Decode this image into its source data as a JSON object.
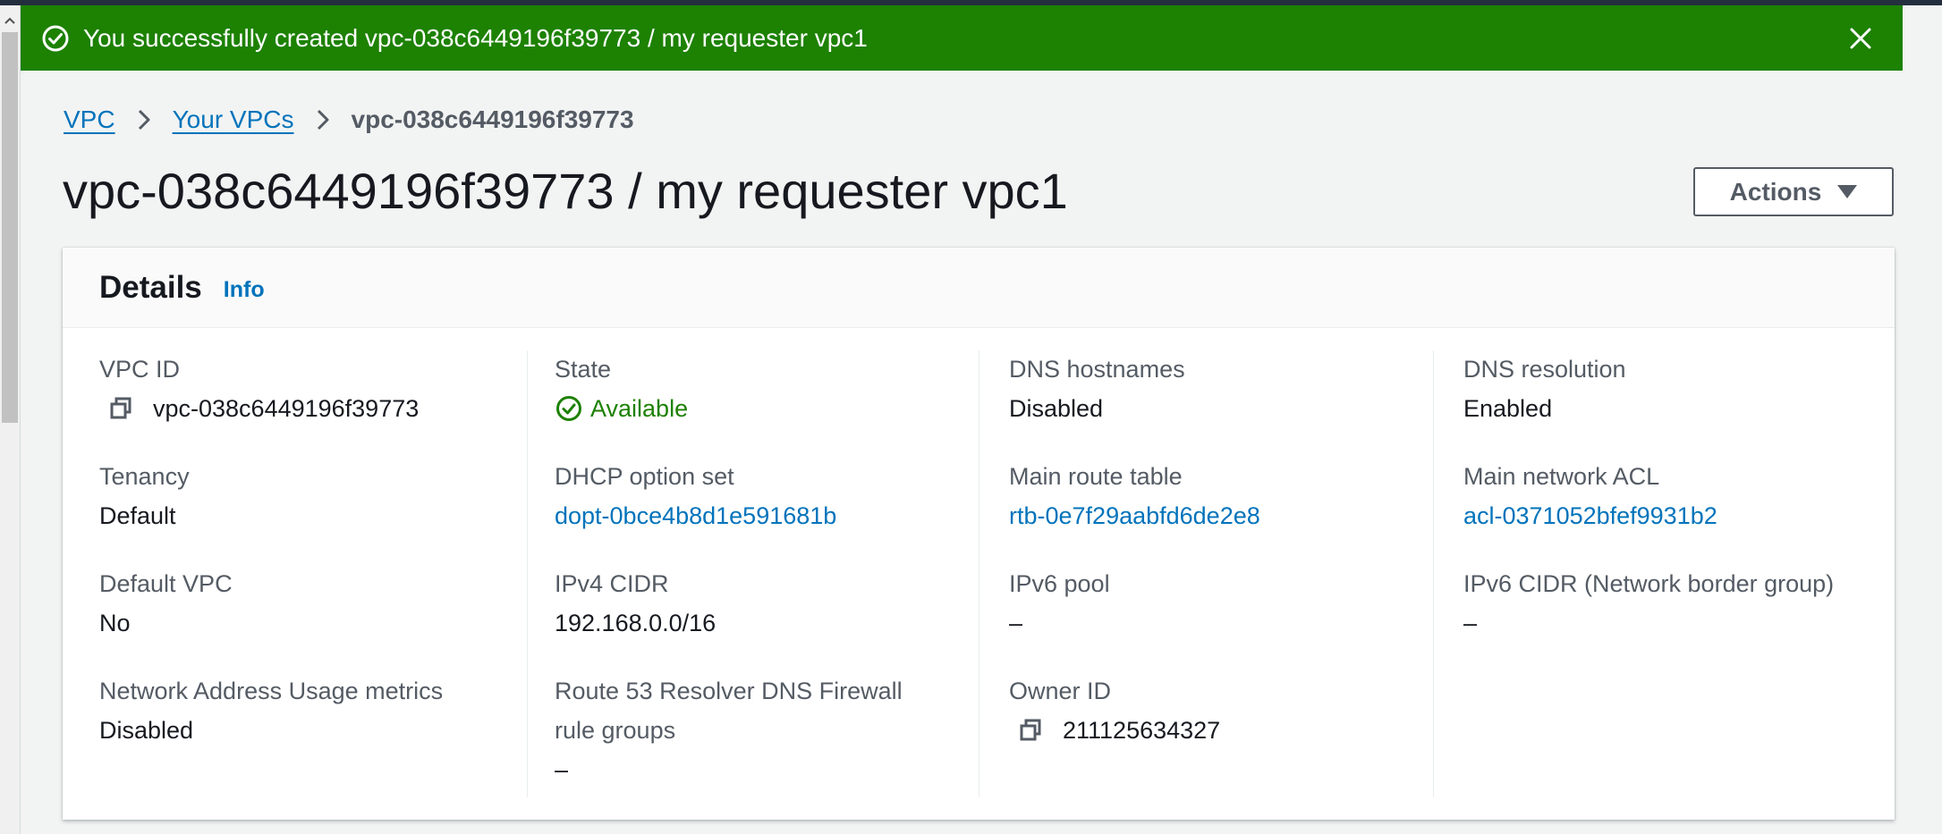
{
  "flash": {
    "message": "You successfully created vpc-038c6449196f39773 / my requester vpc1",
    "type": "success",
    "color": "#1d8102"
  },
  "breadcrumb": {
    "items": [
      "VPC",
      "Your VPCs"
    ],
    "current": "vpc-038c6449196f39773"
  },
  "page": {
    "title": "vpc-038c6449196f39773 / my requester vpc1",
    "actions_label": "Actions"
  },
  "details": {
    "title": "Details",
    "info_label": "Info",
    "columns": [
      [
        {
          "label": "VPC ID",
          "value": "vpc-038c6449196f39773"
        },
        {
          "label": "Tenancy",
          "value": "Default"
        },
        {
          "label": "Default VPC",
          "value": "No"
        },
        {
          "label": "Network Address Usage metrics",
          "value": "Disabled"
        }
      ],
      [
        {
          "label": "State",
          "value": "Available"
        },
        {
          "label": "DHCP option set",
          "value": "dopt-0bce4b8d1e591681b"
        },
        {
          "label": "IPv4 CIDR",
          "value": "192.168.0.0/16"
        },
        {
          "label_line1": "Route 53 Resolver DNS Firewall",
          "label_line2": "rule groups",
          "value": "–"
        }
      ],
      [
        {
          "label": "DNS hostnames",
          "value": "Disabled"
        },
        {
          "label": "Main route table",
          "value": "rtb-0e7f29aabfd6de2e8"
        },
        {
          "label": "IPv6 pool",
          "value": "–"
        },
        {
          "label": "Owner ID",
          "value": "211125634327"
        }
      ],
      [
        {
          "label": "DNS resolution",
          "value": "Enabled"
        },
        {
          "label": "Main network ACL",
          "value": "acl-0371052bfef9931b2"
        },
        {
          "label": "IPv6 CIDR (Network border group)",
          "value": "–"
        }
      ]
    ]
  },
  "colors": {
    "link": "#0073bb",
    "success": "#1d8102",
    "label": "#545b64",
    "text": "#16191f"
  }
}
